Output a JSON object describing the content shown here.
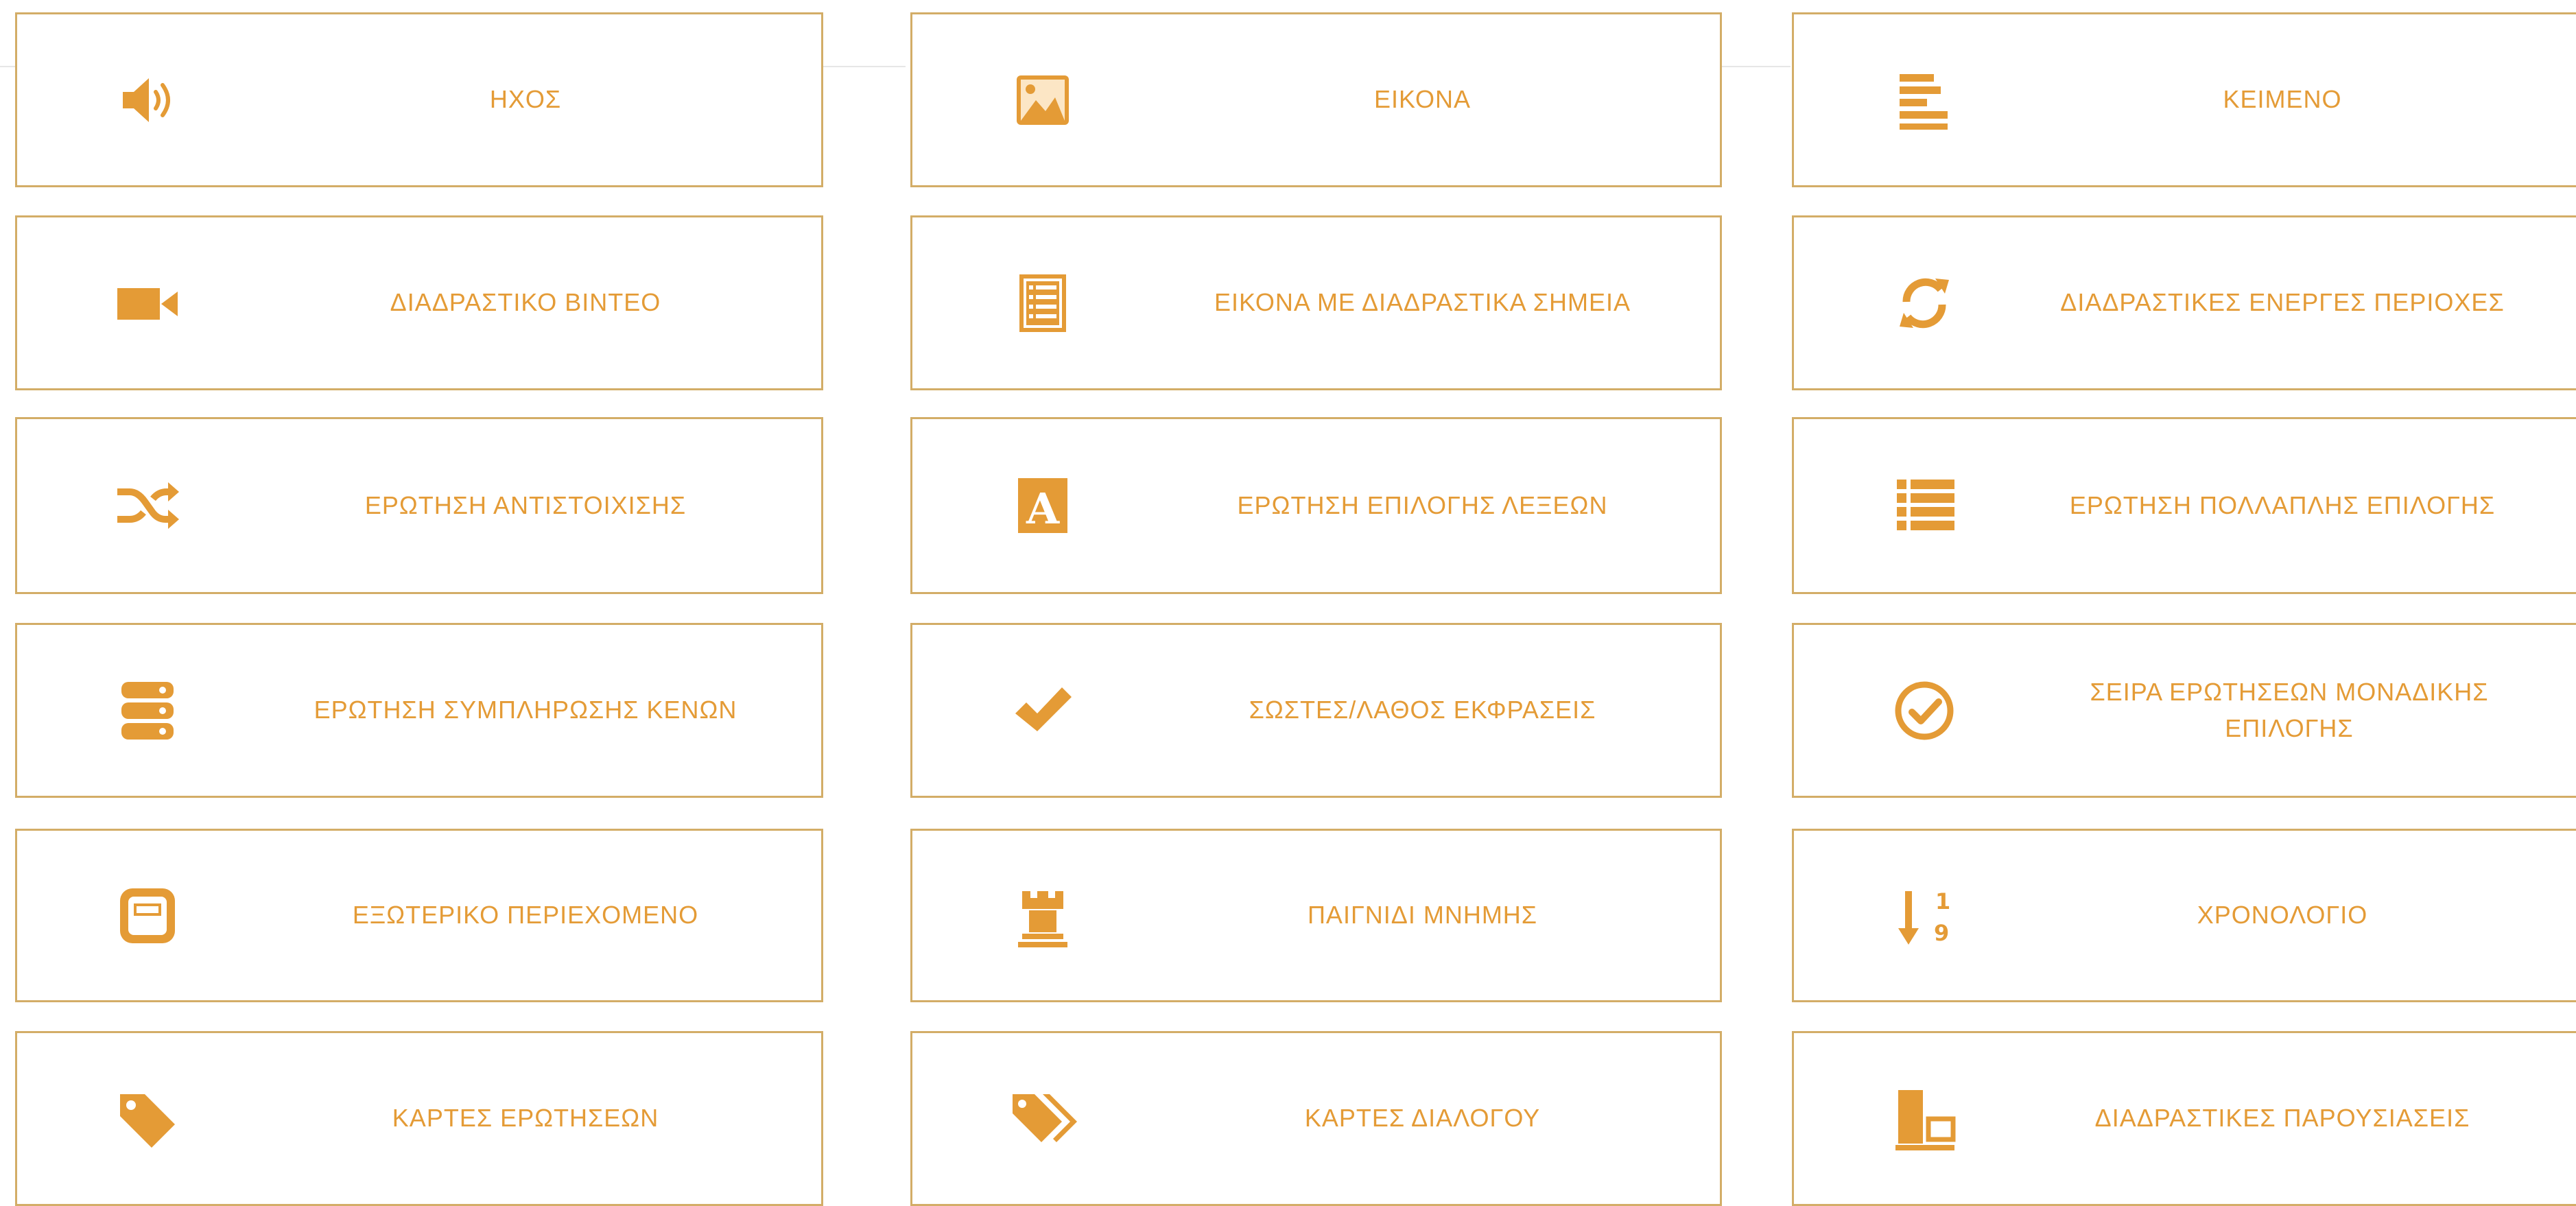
{
  "accent_color": "#e49b36",
  "border_color": "#d3ad67",
  "tiles": [
    {
      "label": "ΗΧΟΣ",
      "icon": "speaker-icon"
    },
    {
      "label": "ΕΙΚΟΝΑ",
      "icon": "image-icon"
    },
    {
      "label": "ΚΕΙΜΕΝΟ",
      "icon": "text-lines-icon"
    },
    {
      "label": "ΔΙΑΔΡΑΣΤΙΚΟ ΒΙΝΤΕΟ",
      "icon": "video-camera-icon"
    },
    {
      "label": "ΕΙΚΟΝΑ ΜΕ ΔΙΑΔΡΑΣΤΙΚΑ ΣΗΜΕΙΑ",
      "icon": "list-document-icon"
    },
    {
      "label": "ΔΙΑΔΡΑΣΤΙΚΕΣ ΕΝΕΡΓΕΣ ΠΕΡΙΟΧΕΣ",
      "icon": "refresh-icon"
    },
    {
      "label": "ΕΡΩΤΗΣΗ ΑΝΤΙΣΤΟΙΧΙΣΗΣ",
      "icon": "shuffle-icon"
    },
    {
      "label": "ΕΡΩΤΗΣΗ ΕΠΙΛΟΓΗΣ ΛΕΞΕΩΝ",
      "icon": "letter-a-icon"
    },
    {
      "label": "ΕΡΩΤΗΣΗ ΠΟΛΛΑΠΛΗΣ ΕΠΙΛΟΓΗΣ",
      "icon": "bullet-list-icon"
    },
    {
      "label": "ΕΡΩΤΗΣΗ ΣΥΜΠΛΗΡΩΣΗΣ ΚΕΝΩΝ",
      "icon": "server-stack-icon"
    },
    {
      "label": "ΣΩΣΤΕΣ/ΛΑΘΟΣ ΕΚΦΡΑΣΕΙΣ",
      "icon": "checkmark-icon"
    },
    {
      "label": "ΣΕΙΡΑ ΕΡΩΤΗΣΕΩΝ ΜΟΝΑΔΙΚΗΣ ΕΠΙΛΟΓΗΣ",
      "icon": "check-circle-icon"
    },
    {
      "label": "ΕΞΩΤΕΡΙΚΟ ΠΕΡΙΕΧΟΜΕΝΟ",
      "icon": "embed-box-icon"
    },
    {
      "label": "ΠΑΙΓΝΙΔΙ ΜΝΗΜΗΣ",
      "icon": "chess-rook-icon"
    },
    {
      "label": "ΧΡΟΝΟΛΟΓΙΟ",
      "icon": "sort-numeric-icon"
    },
    {
      "label": "ΚΑΡΤΕΣ ΕΡΩΤΗΣΕΩΝ",
      "icon": "tag-icon"
    },
    {
      "label": "ΚΑΡΤΕΣ ΔΙΑΛΟΓΟΥ",
      "icon": "tags-icon"
    },
    {
      "label": "ΔΙΑΔΡΑΣΤΙΚΕΣ ΠΑΡΟΥΣΙΑΣΕΙΣ",
      "icon": "presentation-icon"
    }
  ]
}
